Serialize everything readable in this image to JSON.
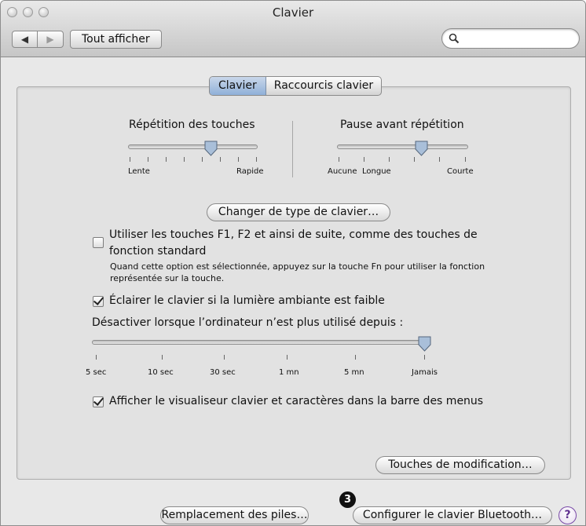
{
  "window": {
    "title": "Clavier"
  },
  "toolbar": {
    "back_icon": "◀",
    "forward_icon": "▶",
    "show_all_label": "Tout afficher",
    "search_value": "",
    "search_placeholder": ""
  },
  "tabs": [
    {
      "label": "Clavier",
      "active": true
    },
    {
      "label": "Raccourcis clavier",
      "active": false
    }
  ],
  "key_repeat": {
    "title": "Répétition des touches",
    "min_label": "Lente",
    "max_label": "Rapide",
    "tick_count": 8,
    "selected_index": 5
  },
  "delay_until_repeat": {
    "title": "Pause avant répétition",
    "min_label": "Aucune",
    "mid_label": "Longue",
    "max_label": "Courte",
    "tick_count": 6,
    "selected_index": 4
  },
  "change_keyboard_type_label": "Changer de type de clavier…",
  "fn_keys": {
    "checked": false,
    "label_line1": "Utiliser les touches F1, F2 et ainsi de suite, comme des touches de",
    "label_line2": "fonction standard",
    "note": "Quand cette option est sélectionnée, appuyez sur la touche Fn pour utiliser la fonction représentée sur la touche."
  },
  "illuminate": {
    "checked": true,
    "label": "Éclairer le clavier si la lumière ambiante est faible"
  },
  "turn_off": {
    "title": "Désactiver lorsque l’ordinateur n’est plus utilisé depuis :",
    "ticks": [
      "5 sec",
      "10 sec",
      "30 sec",
      "1 mn",
      "5 mn",
      "Jamais"
    ],
    "selected": "Jamais"
  },
  "show_viewer": {
    "checked": true,
    "label": "Afficher le visualiseur clavier et caractères dans la barre des menus"
  },
  "modifier_keys_label": "Touches de modification…",
  "bottom": {
    "battery_label": "Remplacement des piles…",
    "bluetooth_label": "Configurer le clavier Bluetooth…",
    "callout_number": "3",
    "help_label": "?"
  },
  "colors": {
    "tab_active": "#9db8dd",
    "callout": "#111111",
    "help_accent": "#7a4aa7"
  }
}
